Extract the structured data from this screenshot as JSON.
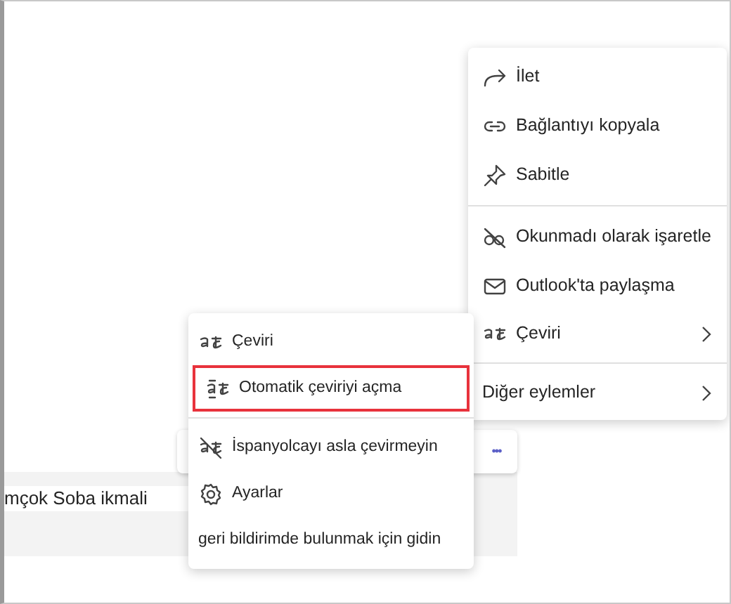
{
  "message": {
    "text": "mçok Soba ikmali",
    "more_button": "•••"
  },
  "main_menu": {
    "groups": [
      [
        {
          "label": "İlet",
          "has_submenu": false
        },
        {
          "label": "Bağlantıyı kopyala",
          "has_submenu": false
        },
        {
          "label": "Sabitle",
          "has_submenu": false
        }
      ],
      [
        {
          "label": "Okunmadı olarak işaretle",
          "has_submenu": false
        },
        {
          "label": "Outlook'ta paylaşma",
          "has_submenu": false
        },
        {
          "label": "Çeviri",
          "has_submenu": true
        }
      ],
      [
        {
          "label": "Diğer eylemler",
          "has_submenu": true
        }
      ]
    ]
  },
  "translate_menu": {
    "groups": [
      [
        {
          "label": "Çeviri",
          "outlined": false
        },
        {
          "label": "Otomatik çeviriyi açma",
          "outlined": true
        }
      ],
      [
        {
          "label": "İspanyolcayı asla çevirmeyin",
          "outlined": false
        },
        {
          "label": "Ayarlar",
          "outlined": false
        },
        {
          "label": "geri bildirimde bulunmak için gidin",
          "outlined": false
        }
      ]
    ]
  }
}
